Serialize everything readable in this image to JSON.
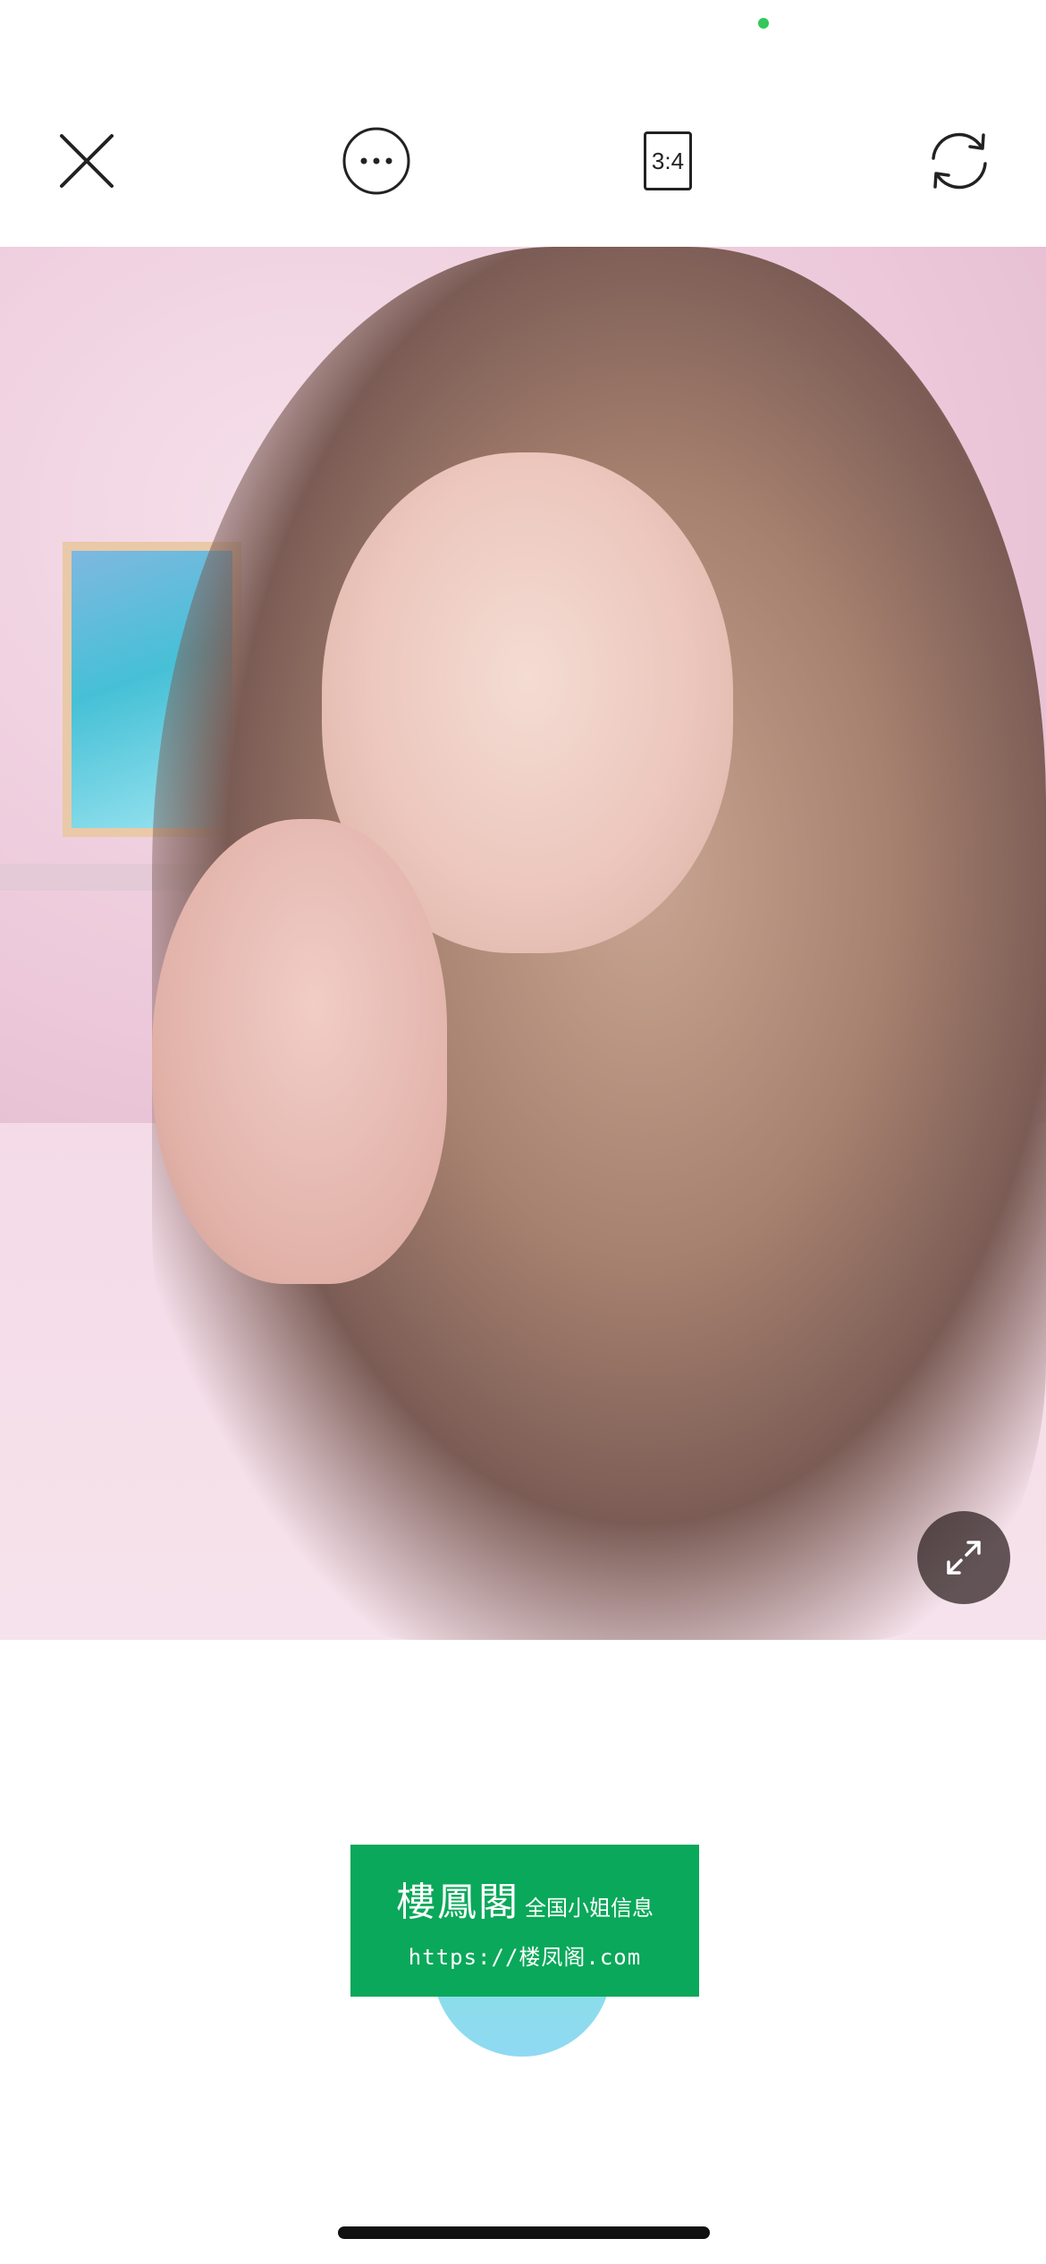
{
  "status_bar": {
    "indicator_color": "#34c759"
  },
  "toolbar": {
    "close_icon": "close-icon",
    "more_icon": "more-options-icon",
    "aspect_ratio_label": "3:4",
    "rotate_icon": "rotate-icon"
  },
  "photo": {
    "expand_icon": "expand-icon"
  },
  "watermark": {
    "title": "樓鳳閣",
    "subtitle": "全国小姐信息",
    "url": "https://楼凤阁.com",
    "background": "#0aa85a"
  },
  "colors": {
    "background": "#ffffff",
    "icon": "#222222"
  }
}
